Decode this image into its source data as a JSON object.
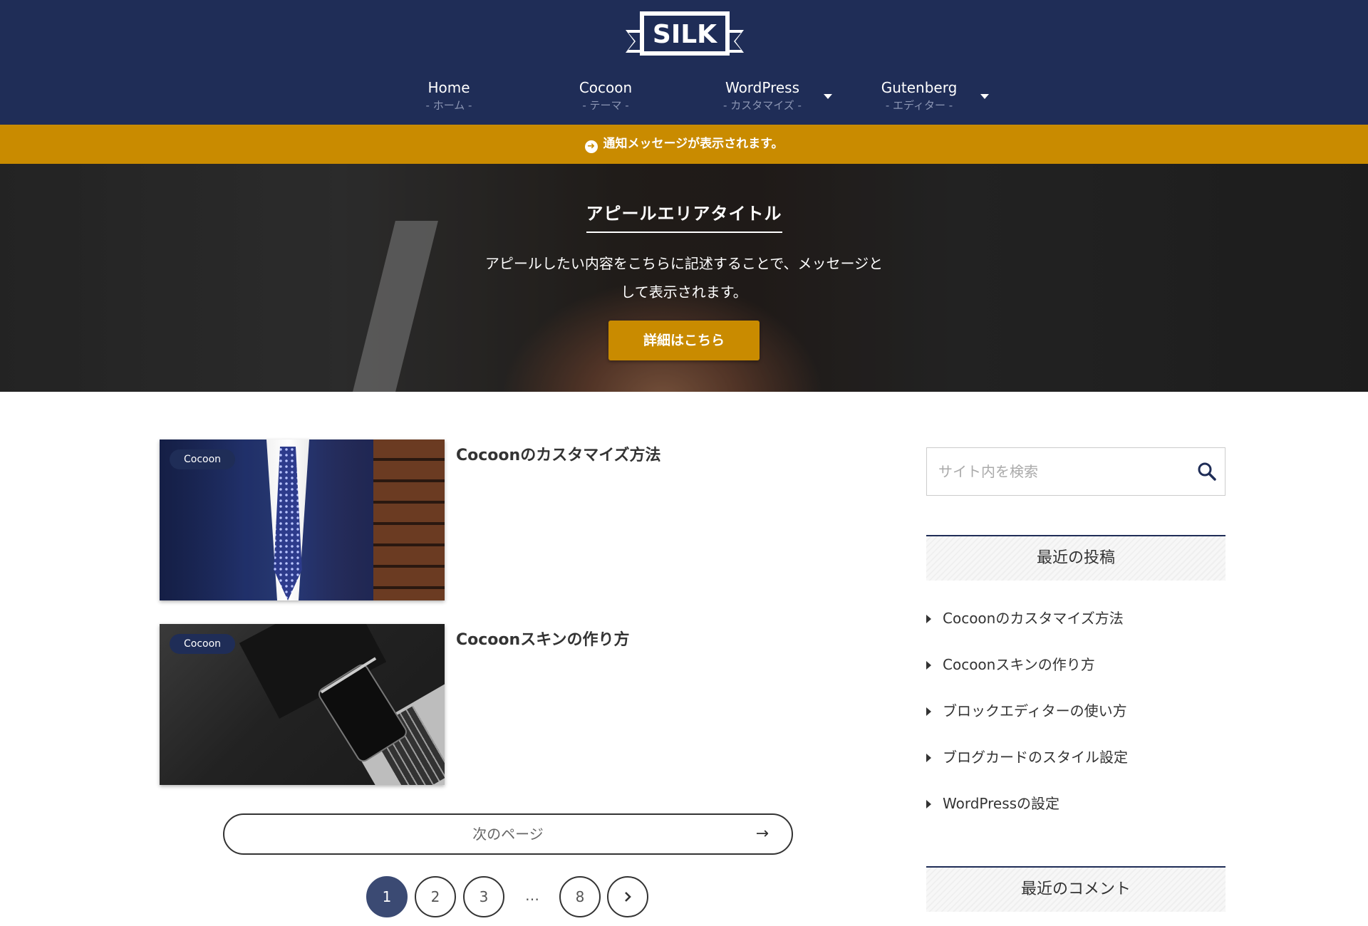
{
  "header": {
    "logo_text": "SILK",
    "nav": [
      {
        "label": "Home",
        "sub": "- ホーム -",
        "has_dropdown": false
      },
      {
        "label": "Cocoon",
        "sub": "- テーマ -",
        "has_dropdown": false
      },
      {
        "label": "WordPress",
        "sub": "- カスタマイズ -",
        "has_dropdown": true
      },
      {
        "label": "Gutenberg",
        "sub": "- エディター -",
        "has_dropdown": true
      }
    ]
  },
  "notice": {
    "icon": "arrow-circle-right-icon",
    "text": "通知メッセージが表示されます。"
  },
  "appeal": {
    "title": "アピールエリアタイトル",
    "text_line1": "アピールしたい内容をこちらに記述することで、メッセージと",
    "text_line2": "して表示されます。",
    "button_label": "詳細はこちら"
  },
  "entries": [
    {
      "category": "Cocoon",
      "title": "Cocoonのカスタマイズ方法"
    },
    {
      "category": "Cocoon",
      "title": "Cocoonスキンの作り方"
    }
  ],
  "pager": {
    "next_label": "次のページ",
    "next_arrow": "→",
    "pages": [
      "1",
      "2",
      "3",
      "…",
      "8"
    ],
    "current": "1",
    "next_icon": "chevron-right-icon"
  },
  "sidebar": {
    "search_placeholder": "サイト内を検索",
    "recent_posts_title": "最近の投稿",
    "recent_posts": [
      "Cocoonのカスタマイズ方法",
      "Cocoonスキンの作り方",
      "ブロックエディターの使い方",
      "ブログカードのスタイル設定",
      "WordPressの設定"
    ],
    "recent_comments_title": "最近のコメント"
  },
  "colors": {
    "brand_navy": "#1f2d57",
    "accent_gold": "#c98b00",
    "pager_current": "#3b4a73"
  }
}
